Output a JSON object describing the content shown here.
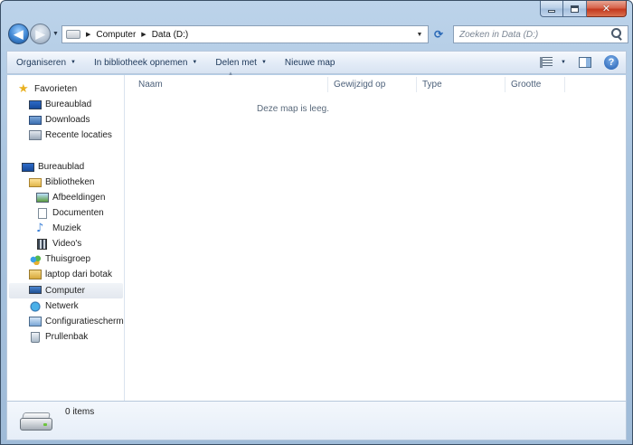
{
  "window": {
    "caption_min": "–",
    "caption_close": "✕"
  },
  "nav": {
    "back_glyph": "◀",
    "forward_glyph": "▶",
    "history_dropdown": "▼",
    "address": {
      "crumbs": [
        "Computer",
        "Data (D:)"
      ],
      "separator": "▶",
      "dropdown": "▼"
    },
    "refresh_glyph": "⟳",
    "search_placeholder": "Zoeken in Data (D:)"
  },
  "toolbar": {
    "organize": "Organiseren",
    "include_library": "In bibliotheek opnemen",
    "share_with": "Delen met",
    "new_folder": "Nieuwe map",
    "arrow": "▼",
    "help": "?"
  },
  "sidebar": {
    "items": [
      {
        "label": "Favorieten",
        "icon": "star-icon"
      },
      {
        "label": "Bureaublad",
        "icon": "desktop-icon"
      },
      {
        "label": "Downloads",
        "icon": "downloads-folder-icon"
      },
      {
        "label": "Recente locaties",
        "icon": "recent-places-icon"
      },
      {
        "label": "Bureaublad",
        "icon": "desktop-icon"
      },
      {
        "label": "Bibliotheken",
        "icon": "libraries-icon"
      },
      {
        "label": "Afbeeldingen",
        "icon": "pictures-icon"
      },
      {
        "label": "Documenten",
        "icon": "documents-icon"
      },
      {
        "label": "Muziek",
        "icon": "music-icon"
      },
      {
        "label": "Video's",
        "icon": "videos-icon"
      },
      {
        "label": "Thuisgroep",
        "icon": "homegroup-icon"
      },
      {
        "label": "laptop dari botak",
        "icon": "user-folder-icon"
      },
      {
        "label": "Computer",
        "icon": "computer-icon"
      },
      {
        "label": "Netwerk",
        "icon": "network-icon"
      },
      {
        "label": "Configuratiescherm",
        "icon": "control-panel-icon"
      },
      {
        "label": "Prullenbak",
        "icon": "recycle-bin-icon"
      }
    ],
    "star_glyph": "★",
    "music_glyph": "♪"
  },
  "file_list": {
    "columns": [
      "Naam",
      "Gewijzigd op",
      "Type",
      "Grootte"
    ],
    "sort_glyph": "▲",
    "empty_message": "Deze map is leeg."
  },
  "details": {
    "item_count": "0 items"
  }
}
